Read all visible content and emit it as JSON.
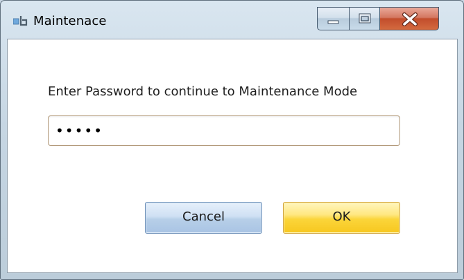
{
  "window": {
    "title": "Maintenace",
    "icon": "application-icon"
  },
  "caption_buttons": {
    "minimize": "minimize-icon",
    "maximize": "maximize-icon",
    "close": "close-icon"
  },
  "dialog": {
    "prompt": "Enter Password to continue to Maintenance Mode",
    "password_value": "•••••"
  },
  "buttons": {
    "cancel_label": "Cancel",
    "ok_label": "OK"
  },
  "colors": {
    "ok_button": "#fbd53a",
    "cancel_button": "#b7cfe8",
    "close_button": "#c24d2c"
  }
}
